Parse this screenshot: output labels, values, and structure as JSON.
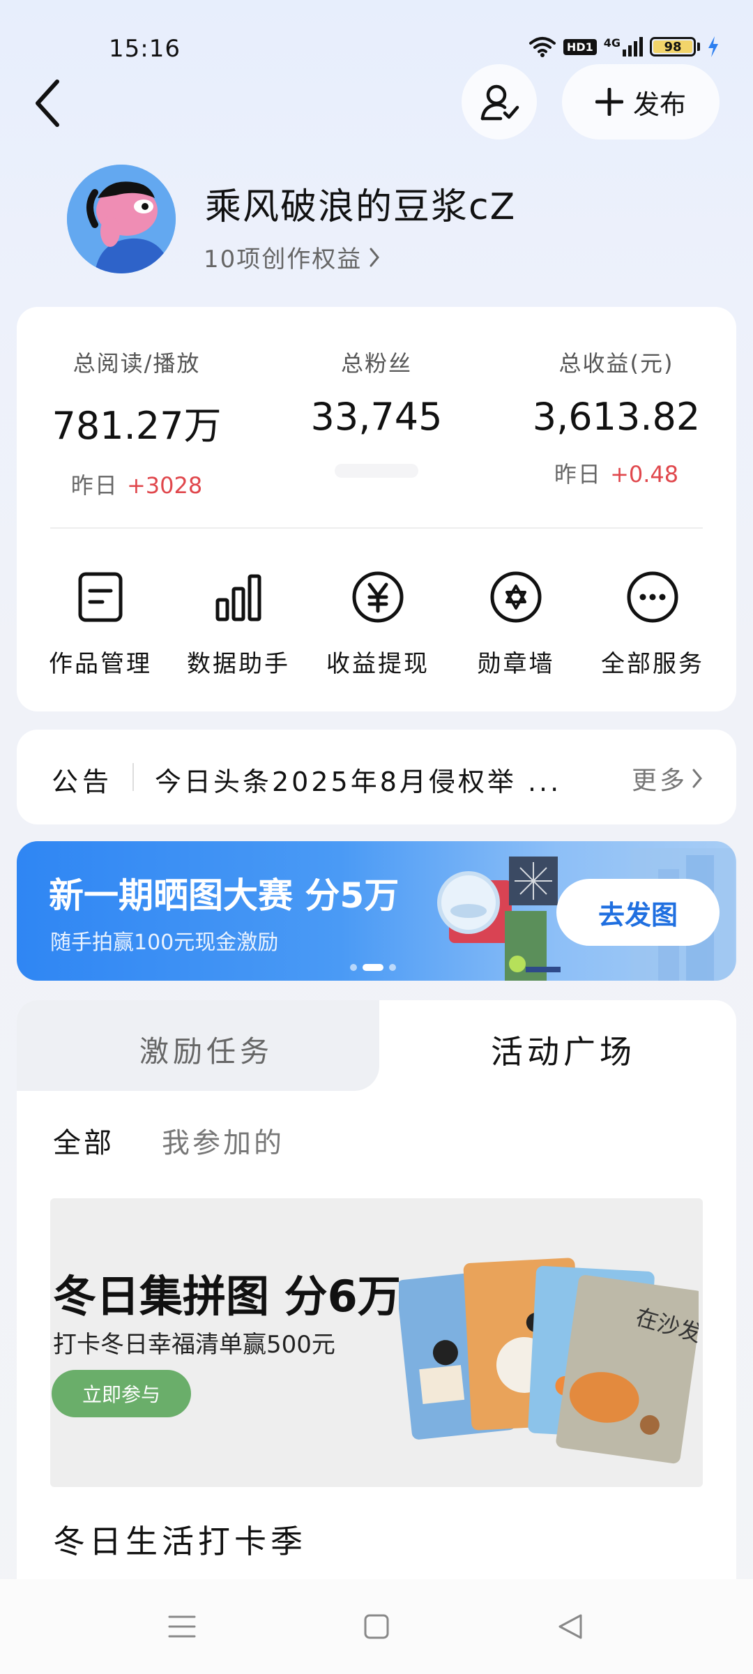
{
  "status_bar": {
    "time": "15:16",
    "hd": "HD1",
    "network": "4G",
    "battery": "98"
  },
  "header": {
    "publish_label": "发布"
  },
  "profile": {
    "username": "乘风破浪的豆浆cZ",
    "rights": "10项创作权益"
  },
  "stats": [
    {
      "label": "总阅读/播放",
      "value": "781.27万",
      "delta_prefix": "昨日",
      "delta": "+3028"
    },
    {
      "label": "总粉丝",
      "value": "33,745"
    },
    {
      "label": "总收益(元)",
      "value": "3,613.82",
      "delta_prefix": "昨日",
      "delta": "+0.48"
    }
  ],
  "services": [
    {
      "label": "作品管理",
      "icon": "document-icon"
    },
    {
      "label": "数据助手",
      "icon": "bar-chart-icon"
    },
    {
      "label": "收益提现",
      "icon": "yuan-icon"
    },
    {
      "label": "勋章墙",
      "icon": "medal-icon"
    },
    {
      "label": "全部服务",
      "icon": "more-icon"
    }
  ],
  "notice": {
    "label": "公告",
    "text": "今日头条2025年8月侵权举 ...",
    "more": "更多"
  },
  "banner": {
    "title": "新一期晒图大赛 分5万",
    "subtitle": "随手拍赢100元现金激励",
    "button": "去发图",
    "slide_count": 3,
    "active_slide": 2
  },
  "tabs": {
    "left": "激励任务",
    "right": "活动广场",
    "active": "活动广场"
  },
  "subtabs": {
    "all": "全部",
    "joined": "我参加的"
  },
  "activity": {
    "title": "冬日集拼图 分6万",
    "subtitle": "打卡冬日幸福清单赢500元",
    "button": "立即参与",
    "card_text": "在沙发小憩",
    "section_title": "冬日生活打卡季"
  },
  "colors": {
    "accent_blue": "#2f86f3",
    "delta_red": "#e0474c",
    "activity_green": "#6aae6a"
  }
}
